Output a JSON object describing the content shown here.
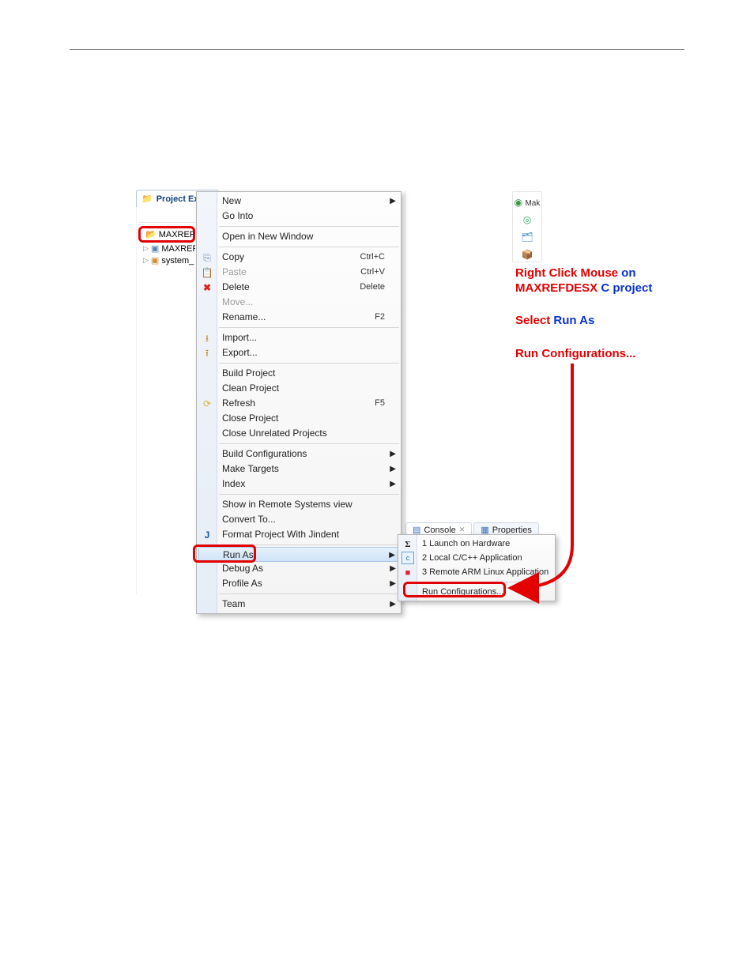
{
  "projectExplorer": {
    "tabLabel": "Project Explo",
    "items": [
      {
        "label": "MAXREF"
      },
      {
        "label": "MAXREF"
      },
      {
        "label": "system_"
      }
    ]
  },
  "contextMenu": {
    "items": [
      {
        "label": "New",
        "arrow": true
      },
      {
        "label": "Go Into"
      },
      {
        "sep": true
      },
      {
        "label": "Open in New Window"
      },
      {
        "sep": true
      },
      {
        "label": "Copy",
        "short": "Ctrl+C",
        "icon": "copy"
      },
      {
        "label": "Paste",
        "short": "Ctrl+V",
        "icon": "paste",
        "disabled": true
      },
      {
        "label": "Delete",
        "short": "Delete",
        "icon": "x"
      },
      {
        "label": "Move...",
        "disabled": true
      },
      {
        "label": "Rename...",
        "short": "F2"
      },
      {
        "sep": true
      },
      {
        "label": "Import...",
        "icon": "import"
      },
      {
        "label": "Export...",
        "icon": "export"
      },
      {
        "sep": true
      },
      {
        "label": "Build Project"
      },
      {
        "label": "Clean Project"
      },
      {
        "label": "Refresh",
        "short": "F5",
        "icon": "refresh"
      },
      {
        "label": "Close Project"
      },
      {
        "label": "Close Unrelated Projects"
      },
      {
        "sep": true
      },
      {
        "label": "Build Configurations",
        "arrow": true
      },
      {
        "label": "Make Targets",
        "arrow": true
      },
      {
        "label": "Index",
        "arrow": true
      },
      {
        "sep": true
      },
      {
        "label": "Show in Remote Systems view"
      },
      {
        "label": "Convert To..."
      },
      {
        "label": "Format Project With Jindent",
        "icon": "jin"
      },
      {
        "sep": true
      },
      {
        "label": "Run As",
        "arrow": true,
        "hovered": true,
        "highlight": true
      },
      {
        "label": "Debug As",
        "arrow": true
      },
      {
        "label": "Profile As",
        "arrow": true
      },
      {
        "sep": true
      },
      {
        "label": "Team",
        "arrow": true
      }
    ]
  },
  "submenu": {
    "items": [
      {
        "label": "1 Launch on Hardware",
        "icon": "sigma"
      },
      {
        "label": "2 Local C/C++ Application",
        "icon": "cpp"
      },
      {
        "label": "3 Remote ARM Linux Application",
        "icon": "dot"
      }
    ],
    "runConfig": "Run Configurations..."
  },
  "rightStrip": {
    "consoleTab": "Console",
    "propertiesTab": "Properties",
    "makLabel": "Mak"
  },
  "annotation": {
    "line1a": "Right Click Mouse",
    "line1b": " on",
    "line2a": "MAXREFDESX",
    "line2b": " C project",
    "line3a": "Select ",
    "line3b": "Run As",
    "line4": "Run Configurations..."
  }
}
